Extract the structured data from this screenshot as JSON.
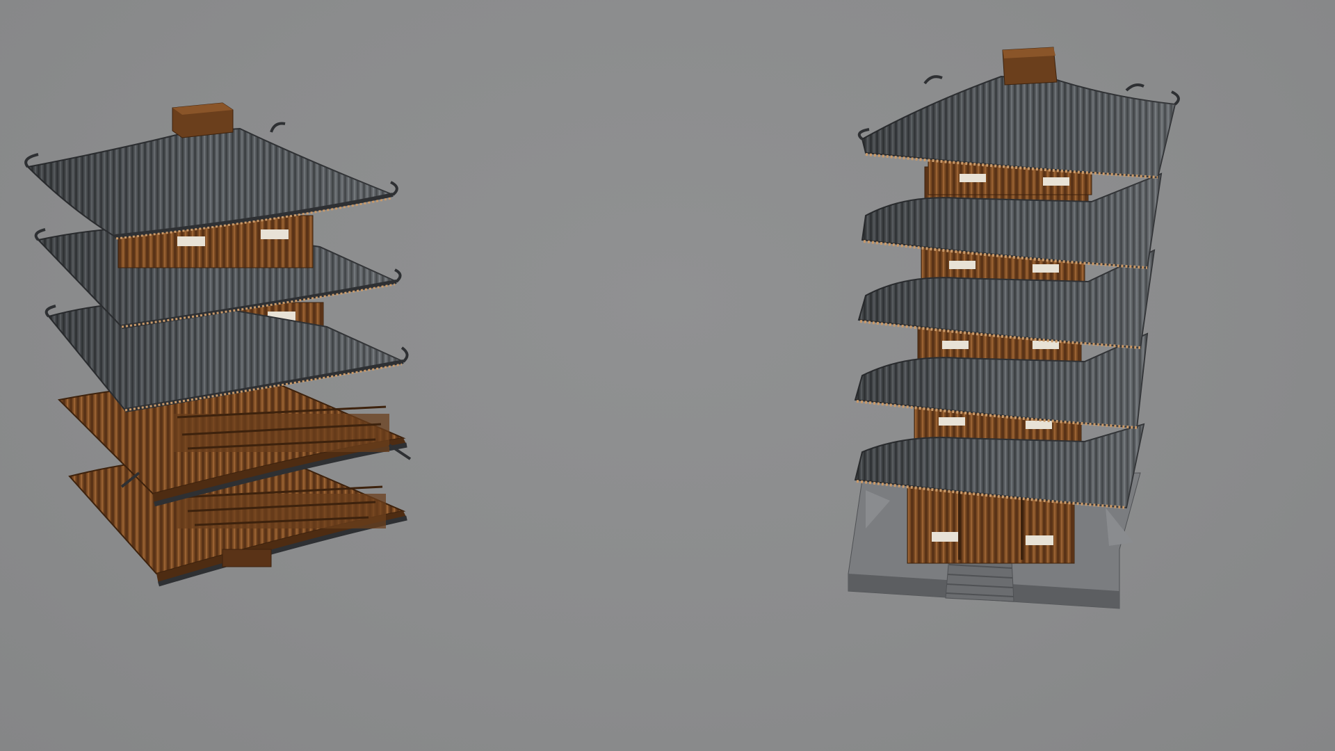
{
  "scene": {
    "kind": "3d-render",
    "models": [
      {
        "name": "exploded-pagoda",
        "tiers": 5,
        "state": "exploded"
      },
      {
        "name": "assembled-pagoda",
        "tiers": 5,
        "state": "assembled"
      }
    ]
  },
  "colors": {
    "background": "#8a8b8c",
    "roof": "#54585c",
    "roof_dark": "#3b3e41",
    "roof_light": "#6f7478",
    "wood": "#7a4a22",
    "wood_dark": "#4e2c12",
    "wood_light": "#9a6233",
    "plaster": "#e8e2d6",
    "base": "#7b7d80",
    "base_dark": "#5c5e61"
  }
}
